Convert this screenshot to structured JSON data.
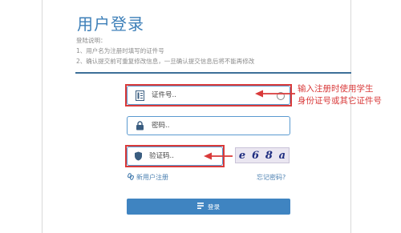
{
  "title": "用户登录",
  "notes": {
    "heading": "登陆说明：",
    "line1": "1、用户名为注册时填写的证件号",
    "line2": "2、确认提交前可重复修改信息，一旦确认提交信息后将不能再修改"
  },
  "form": {
    "id_placeholder": "证件号..",
    "password_placeholder": "密码..",
    "captcha_placeholder": "验证码..",
    "captcha_chars": [
      "e",
      "6",
      "8",
      "a"
    ]
  },
  "annotation": {
    "line1": "输入注册时使用学生",
    "line2": "身份证号或其它证件号"
  },
  "links": {
    "register": "新用户注册",
    "forgot": "忘记密码?"
  },
  "login_button": "登录",
  "colors": {
    "accent": "#3f84c1",
    "highlight": "#d93a3a"
  },
  "icons": [
    "id-card-icon",
    "lock-icon",
    "shield-icon",
    "clear-icon",
    "link-icon",
    "login-icon"
  ]
}
